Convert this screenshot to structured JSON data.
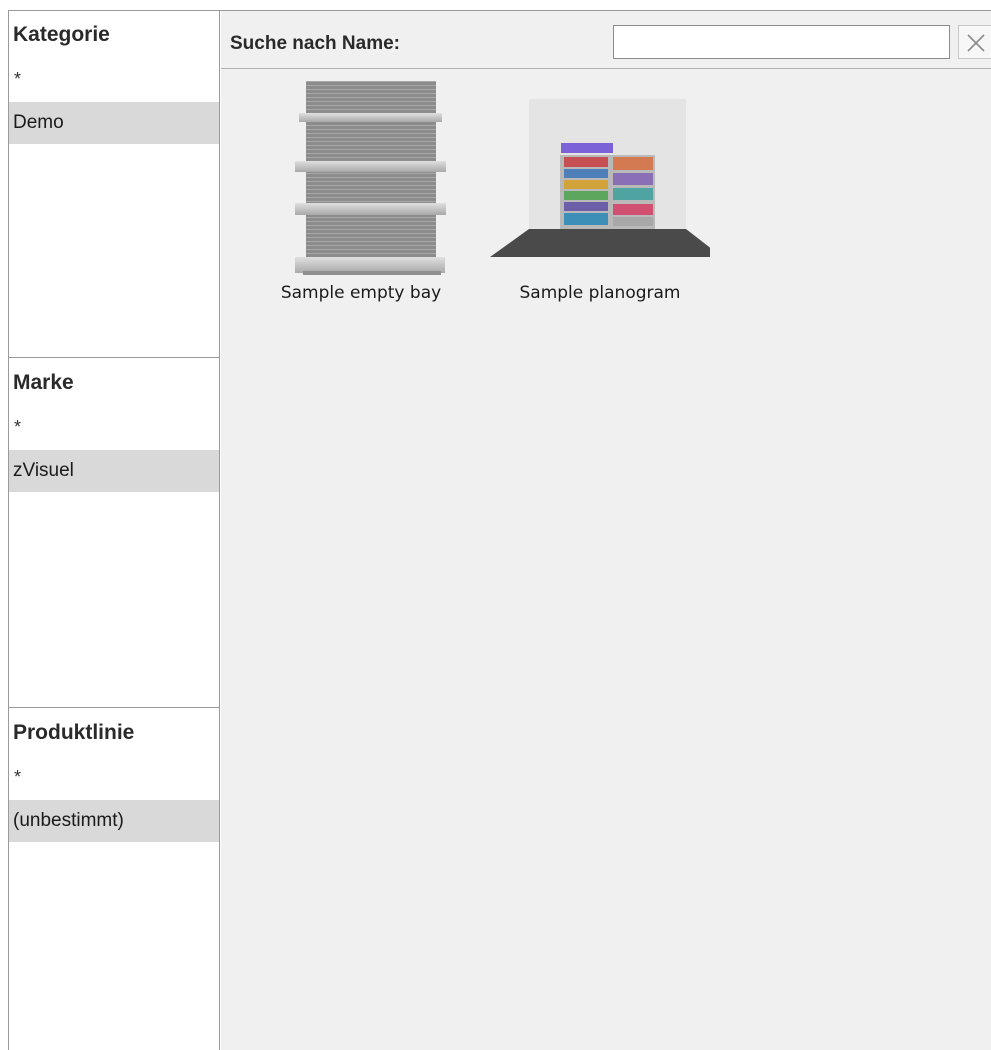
{
  "filters": {
    "category": {
      "title": "Kategorie",
      "all": "*",
      "selected": "Demo"
    },
    "brand": {
      "title": "Marke",
      "all": "*",
      "selected": "zVisuel"
    },
    "product_line": {
      "title": "Produktlinie",
      "all": "*",
      "selected": "(unbestimmt)"
    }
  },
  "search": {
    "label": "Suche nach Name:",
    "value": "",
    "placeholder": ""
  },
  "items": [
    {
      "name": "Sample empty bay",
      "icon": "shelf-bay-icon"
    },
    {
      "name": "Sample planogram",
      "icon": "planogram-icon"
    }
  ],
  "colors": {
    "selection": "#d9d9d9",
    "panel_bg": "#f0f0f0",
    "border": "#9a9a9a"
  }
}
